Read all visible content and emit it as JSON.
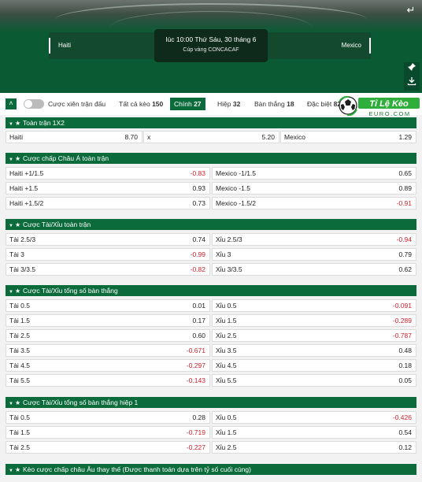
{
  "header": {
    "home_team": "Haiti",
    "away_team": "Mexico",
    "match_time": "lúc 10:00 Thứ Sáu, 30 tháng 6",
    "league": "Cúp vàng CONCACAF",
    "back_icon": "back-arrow-icon",
    "pin_icon": "pin-icon",
    "download_icon": "download-icon"
  },
  "tabs": {
    "parlay_label": "Cược xiên trận đấu",
    "items": [
      {
        "label": "Tất cả kèo",
        "count": "150"
      },
      {
        "label": "Chính",
        "count": "27"
      },
      {
        "label": "Hiệp",
        "count": "32"
      },
      {
        "label": "Bàn thắng",
        "count": "18"
      },
      {
        "label": "Đặc biệt",
        "count": "82"
      }
    ]
  },
  "logo": {
    "name": "Tỉ Lệ Kèo",
    "sub": "EURO.COM"
  },
  "sections": [
    {
      "title": "Toàn trận 1X2",
      "rows": [
        [
          {
            "label": "Haiti",
            "value": "8.70"
          },
          {
            "label": "x",
            "value": "5.20"
          },
          {
            "label": "Mexico",
            "value": "1.29"
          }
        ]
      ]
    },
    {
      "title": "Cược chấp Châu Á toàn trận",
      "rows": [
        [
          {
            "label": "Haiti +1/1.5",
            "value": "-0.83"
          },
          {
            "label": "Mexico -1/1.5",
            "value": "0.65"
          }
        ],
        [
          {
            "label": "Haiti +1.5",
            "value": "0.93"
          },
          {
            "label": "Mexico -1.5",
            "value": "0.89"
          }
        ],
        [
          {
            "label": "Haiti +1.5/2",
            "value": "0.73"
          },
          {
            "label": "Mexico -1.5/2",
            "value": "-0.91"
          }
        ]
      ]
    },
    {
      "title": "Cược Tài/Xỉu toàn trận",
      "rows": [
        [
          {
            "label": "Tài 2.5/3",
            "value": "0.74"
          },
          {
            "label": "Xỉu 2.5/3",
            "value": "-0.94"
          }
        ],
        [
          {
            "label": "Tài 3",
            "value": "-0.99"
          },
          {
            "label": "Xỉu 3",
            "value": "0.79"
          }
        ],
        [
          {
            "label": "Tài 3/3.5",
            "value": "-0.82"
          },
          {
            "label": "Xỉu 3/3.5",
            "value": "0.62"
          }
        ]
      ]
    },
    {
      "title": "Cược Tài/Xỉu tổng số bàn thắng",
      "rows": [
        [
          {
            "label": "Tài 0.5",
            "value": "0.01"
          },
          {
            "label": "Xỉu 0.5",
            "value": "-0.091"
          }
        ],
        [
          {
            "label": "Tài 1.5",
            "value": "0.17"
          },
          {
            "label": "Xỉu 1.5",
            "value": "-0.289"
          }
        ],
        [
          {
            "label": "Tài 2.5",
            "value": "0.60"
          },
          {
            "label": "Xỉu 2.5",
            "value": "-0.787"
          }
        ],
        [
          {
            "label": "Tài 3.5",
            "value": "-0.671"
          },
          {
            "label": "Xỉu 3.5",
            "value": "0.48"
          }
        ],
        [
          {
            "label": "Tài 4.5",
            "value": "-0.297"
          },
          {
            "label": "Xỉu 4.5",
            "value": "0.18"
          }
        ],
        [
          {
            "label": "Tài 5.5",
            "value": "-0.143"
          },
          {
            "label": "Xỉu 5.5",
            "value": "0.05"
          }
        ]
      ]
    },
    {
      "title": "Cược Tài/Xỉu tổng số bàn thắng hiệp 1",
      "rows": [
        [
          {
            "label": "Tài 0.5",
            "value": "0.28"
          },
          {
            "label": "Xỉu 0.5",
            "value": "-0.426"
          }
        ],
        [
          {
            "label": "Tài 1.5",
            "value": "-0.719"
          },
          {
            "label": "Xỉu 1.5",
            "value": "0.54"
          }
        ],
        [
          {
            "label": "Tài 2.5",
            "value": "-0.227"
          },
          {
            "label": "Xỉu 2.5",
            "value": "0.12"
          }
        ]
      ]
    },
    {
      "title": "Kèo cược chấp châu Âu thay thế (Được thanh toán dựa trên tỷ số cuối cùng)",
      "rows": []
    }
  ],
  "colors": {
    "brand_green": "#0b6b3a",
    "negative_red": "#d6202a",
    "header_green": "#0a5a33"
  }
}
